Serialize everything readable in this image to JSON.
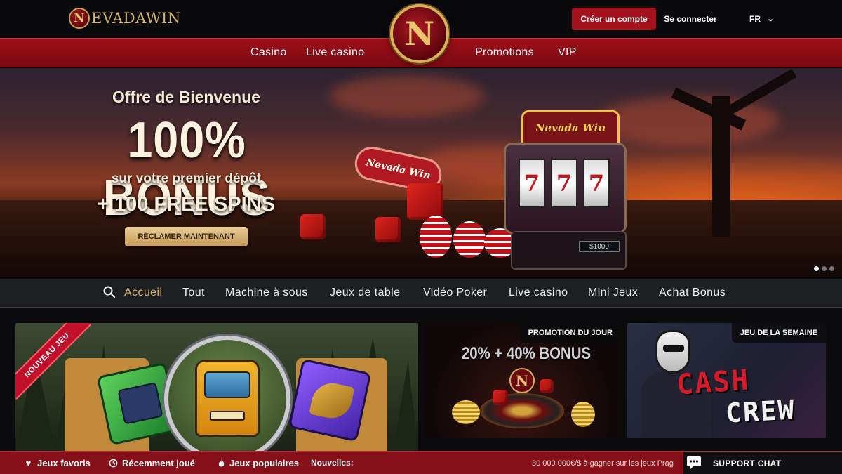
{
  "header": {
    "logo_initial": "N",
    "logo_text": "EVADAWIN",
    "register_label": "Créer un compte",
    "login_label": "Se connecter",
    "language": "FR"
  },
  "nav": {
    "items": [
      "Casino",
      "Live casino",
      "Promotions",
      "VIP"
    ],
    "emblem_letter": "N"
  },
  "hero": {
    "title": "Offre de Bienvenue",
    "headline": "100% BONUS",
    "subtitle": "sur votre premier dépôt",
    "spins": "+ 100 FREE SPINS",
    "cta": "RÉCLAMER MAINTENANT",
    "sign_text": "Nevada Win",
    "slot_brand": "Nevada Win",
    "slot_reels": [
      "7",
      "7",
      "7"
    ],
    "slot_amount": "$1000",
    "slides_total": 3,
    "slide_active": 1
  },
  "categories": {
    "items": [
      "Accueil",
      "Tout",
      "Machine à sous",
      "Jeux de table",
      "Vidéo Poker",
      "Live casino",
      "Mini Jeux",
      "Achat Bonus"
    ],
    "active_index": 0
  },
  "cards": {
    "new_game_badge": "NOUVEAU JEU",
    "promo_tag": "PROMOTION DU JOUR",
    "promo_text": "20% + 40% BONUS",
    "promo_emblem": "N",
    "game_week_tag": "JEU DE LA SEMAINE",
    "game_week_title_1": "CASH",
    "game_week_title_2": "CREW"
  },
  "footer": {
    "favorites": "Jeux favoris",
    "recent": "Récemment joué",
    "popular": "Jeux populaires",
    "news_label": "Nouvelles:",
    "ticker": "30 000 000€/$ à gagner sur les jeux Prag",
    "support": "SUPPORT CHAT"
  },
  "colors": {
    "brand_red": "#a4101b",
    "gold": "#d7b06a",
    "footer_red": "#86101a"
  },
  "icons": {
    "search": "search-icon",
    "heart": "heart-icon",
    "clock": "clock-icon",
    "fire": "fire-icon",
    "chat": "chat-icon",
    "chevron": "chevron-down-icon"
  }
}
